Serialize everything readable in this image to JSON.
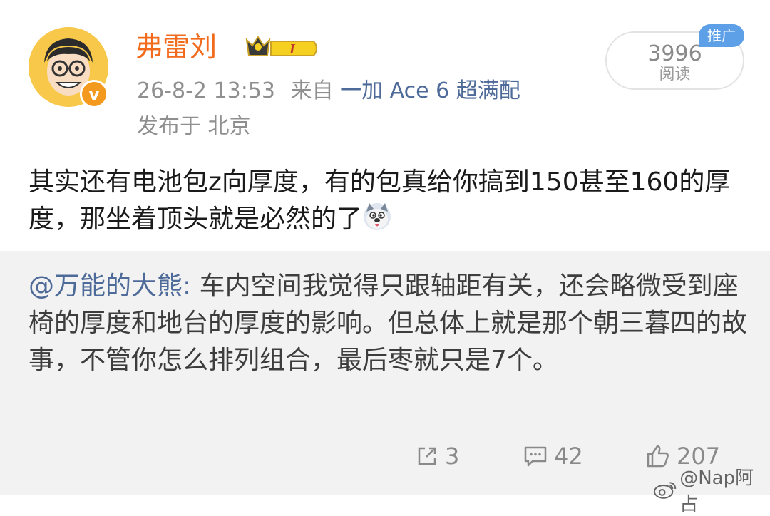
{
  "post": {
    "username": "弗雷刘",
    "member_level": "I",
    "verified_mark": "v",
    "timestamp": "26-8-2 13:53",
    "source_prefix": "来自",
    "device": "一加 Ace 6 超满配",
    "location": "发布于 北京",
    "read_count": "3996",
    "read_label": "阅读",
    "promo_tag": "推广",
    "body": "其实还有电池包z向厚度，有的包真给你搞到150甚至160的厚度，那坐着顶头就是必然的了",
    "emoji": "doge-emoji"
  },
  "quote": {
    "mention": "@万能的大熊:",
    "text": " 车内空间我觉得只跟轴距有关，还会略微受到座椅的厚度和地台的厚度的影响。但总体上就是那个朝三暮四的故事，不管你怎么排列组合，最后枣就只是7个。"
  },
  "actions": {
    "repost_count": "3",
    "comment_count": "42",
    "like_count": "207"
  },
  "watermark": {
    "text": "@Nap阿占"
  },
  "colors": {
    "username": "#f26a1b",
    "link": "#4e6a98",
    "meta": "#8f8f8f",
    "quote_bg": "#f2f2f2",
    "promo": "#5da0e8",
    "verified": "#f39a1e"
  }
}
